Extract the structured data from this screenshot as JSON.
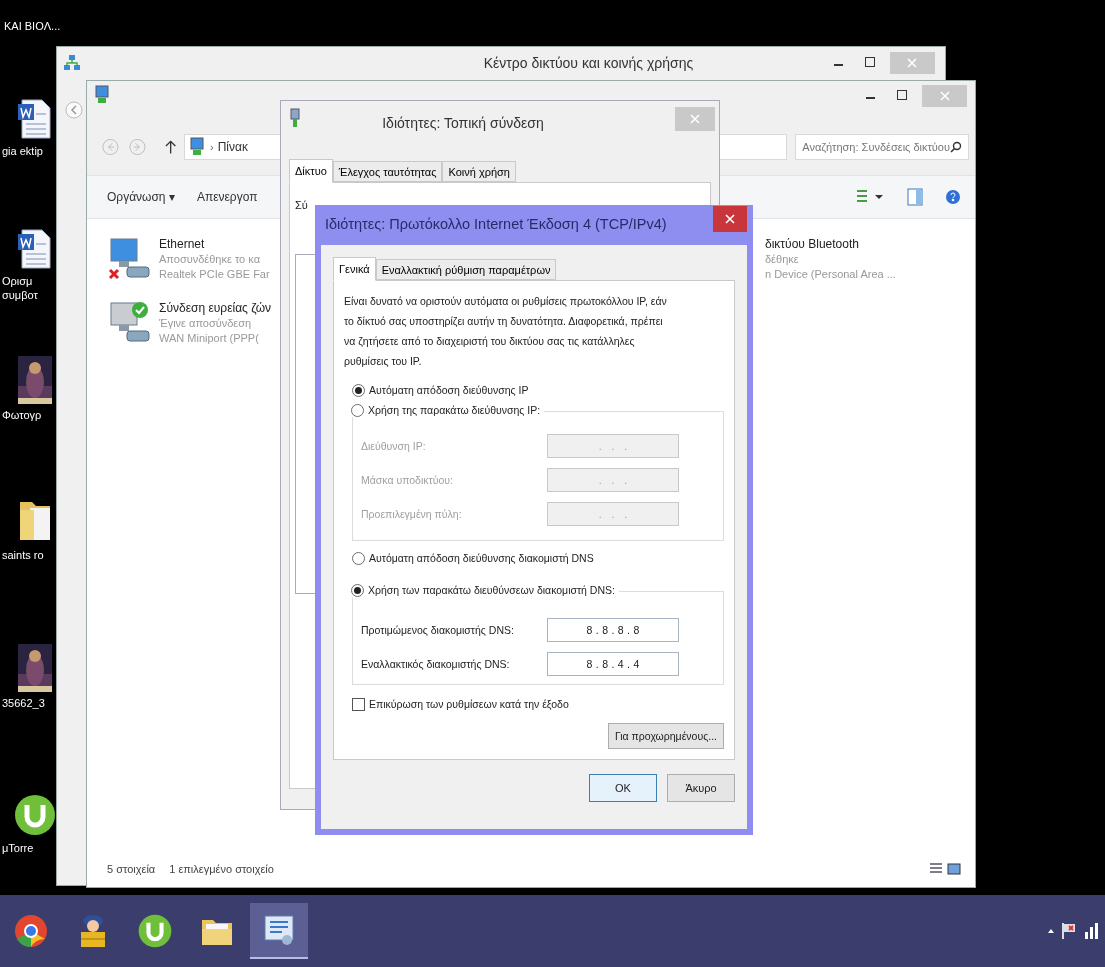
{
  "desktop": {
    "caption": "KAI BIOΛ...",
    "icons": [
      {
        "kind": "document",
        "label": "gia ektip"
      },
      {
        "kind": "document",
        "label": "Ορισμ\nσυμβοτ"
      },
      {
        "label": "Φωτογρ"
      },
      {
        "kind": "folder",
        "label": "saints ro"
      },
      {
        "label": "35662_3"
      },
      {
        "kind": "torrent",
        "label": "μTorre"
      }
    ]
  },
  "network_center": {
    "title": "Κέντρο δικτύου και κοινής χρήσης"
  },
  "connections_window": {
    "breadcrumb_separator": "›",
    "breadcrumb": "Πίνακ",
    "search": {
      "placeholder": "Αναζήτηση: Συνδέσεις δικτύου"
    },
    "toolbar": [
      "Οργάνωση ▾",
      "Απενεργοπ"
    ],
    "items": [
      {
        "kind": "disconnected",
        "name": "Ethernet",
        "status": "Αποσυνδέθηκε το κα",
        "device": "Realtek PCIe GBE Far"
      },
      {
        "kind": "connected",
        "name": "Σύνδεση ευρείας ζών",
        "status": "Έγινε αποσύνδεση",
        "device": "WAN Miniport (PPP("
      }
    ],
    "right_item": {
      "name": "δικτύου Bluetooth",
      "status": "δέθηκε",
      "device": "n Device (Personal Area ..."
    },
    "status_bar": [
      "5 στοιχεία",
      "1 επιλεγμένο στοιχείο"
    ]
  },
  "local_connection_dialog": {
    "title": "Ιδιότητες: Τοπική σύνδεση",
    "tabs": [
      {
        "label": "Δίκτυο",
        "selected": true
      },
      {
        "label": "Έλεγχος ταυτότητας",
        "selected": false
      },
      {
        "label": "Κοινή χρήση",
        "selected": false
      }
    ],
    "label_fragment": "Σύ"
  },
  "ipv4_dialog": {
    "title": "Ιδιότητες: Πρωτόκολλο Internet Έκδοση 4 (TCP/IPv4)",
    "tabs": [
      {
        "label": "Γενικά",
        "selected": true
      },
      {
        "label": "Εναλλακτική ρύθμιση παραμέτρων",
        "selected": false
      }
    ],
    "intro": "Είναι δυνατό να οριστούν αυτόματα οι ρυθμίσεις πρωτοκόλλου IP, εάν το δίκτυό σας υποστηρίζει αυτήν τη δυνατότητα. Διαφορετικά, πρέπει να ζητήσετε από το διαχειριστή του δικτύου σας τις κατάλληλες ρυθμίσεις του IP.",
    "ip_options": [
      {
        "label": "Αυτόματη απόδοση διεύθυνσης IP",
        "selected": true
      },
      {
        "label": "Χρήση της παρακάτω διεύθυνσης IP:",
        "selected": false
      }
    ],
    "ip_fields": [
      {
        "label": "Διεύθυνση IP:",
        "value": ".   .   .",
        "disabled": true
      },
      {
        "label": "Μάσκα υποδικτύου:",
        "value": ".   .   .",
        "disabled": true
      },
      {
        "label": "Προεπιλεγμένη πύλη:",
        "value": ".   .   .",
        "disabled": true
      }
    ],
    "dns_options": [
      {
        "label": "Αυτόματη απόδοση διεύθυνσης διακομιστή DNS",
        "selected": false
      },
      {
        "label": "Χρήση των παρακάτω διευθύνσεων διακομιστή DNS:",
        "selected": true
      }
    ],
    "dns_fields": [
      {
        "label": "Προτιμώμενος διακομιστής DNS:",
        "value": "8 . 8 . 8 . 8",
        "disabled": false
      },
      {
        "label": "Εναλλακτικός διακομιστής DNS:",
        "value": "8 . 8 . 4 . 4",
        "disabled": false
      }
    ],
    "validate": {
      "label": "Επικύρωση των ρυθμίσεων κατά την έξοδο",
      "checked": false
    },
    "advanced_button": "Για προχωρημένους...",
    "buttons": [
      "OK",
      "Άκυρο"
    ]
  },
  "taskbar": {
    "apps": [
      {
        "kind": "browser",
        "selected": false
      },
      {
        "kind": "package",
        "selected": false
      },
      {
        "kind": "torrent",
        "selected": false
      },
      {
        "kind": "folder",
        "selected": false
      },
      {
        "kind": "network",
        "selected": true
      }
    ]
  }
}
